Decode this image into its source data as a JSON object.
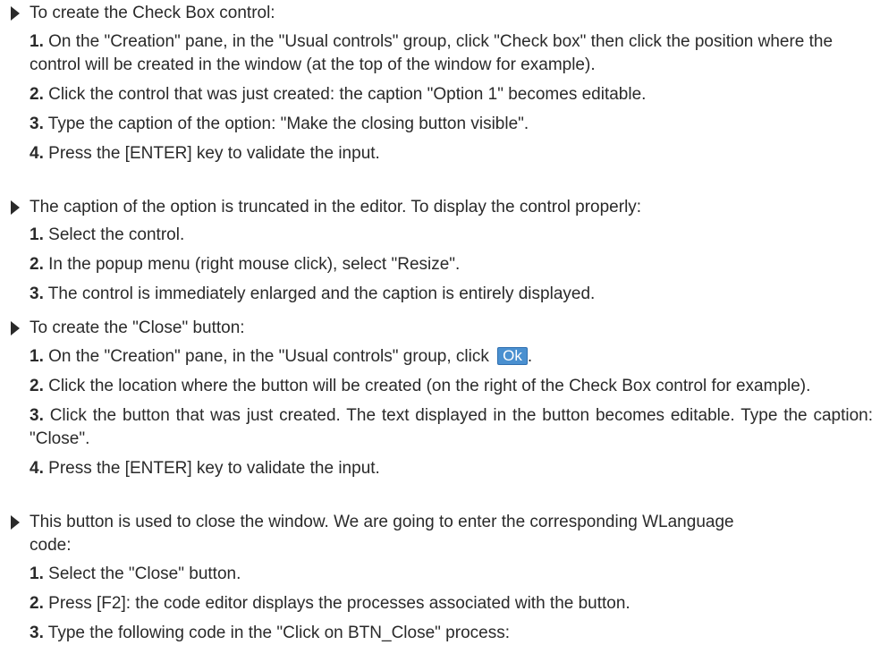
{
  "sections": [
    {
      "lead": "To create the Check Box control:",
      "steps": [
        {
          "num": "1.",
          "text": "On the \"Creation\" pane, in the \"Usual controls\" group, click \"Check box\" then click the position where the control will be created in the window (at the top of the window for example)."
        },
        {
          "num": "2.",
          "text": "Click the control that was just created: the caption \"Option 1\" becomes editable."
        },
        {
          "num": "3.",
          "text": "Type the caption of the option: \"Make the closing button visible\"."
        },
        {
          "num": "4.",
          "text": "Press the [ENTER] key to validate the input."
        }
      ]
    },
    {
      "lead": "The caption of the option is truncated in the editor. To display the control properly:",
      "steps": [
        {
          "num": "1.",
          "text": "Select the control."
        },
        {
          "num": "2.",
          "text": "In the popup menu (right mouse click), select \"Resize\"."
        },
        {
          "num": "3.",
          "text": "The control is immediately enlarged and the caption is entirely displayed."
        }
      ]
    },
    {
      "lead": "To create the \"Close\" button:",
      "steps": [
        {
          "num": "1.",
          "text": "On the \"Creation\" pane, in the \"Usual controls\" group, click",
          "button": "Ok",
          "after": "."
        },
        {
          "num": "2.",
          "text": "Click the location where the button will be created (on the right of the Check Box control for example)."
        },
        {
          "num": "3.",
          "text": "Click the button that was just created. The text displayed in the button becomes editable. Type the caption: \"Close\"."
        },
        {
          "num": "4.",
          "text": "Press the [ENTER] key to validate the input."
        }
      ]
    },
    {
      "lead": "This button is used to close the window. We are going to enter the corresponding WLanguage code:",
      "steps": [
        {
          "num": "1.",
          "text": "Select the \"Close\" button."
        },
        {
          "num": "2.",
          "text": "Press [F2]: the code editor displays the processes associated with the button."
        },
        {
          "num": "3.",
          "text": "Type the following code in the \"Click on BTN_Close\" process:"
        }
      ]
    }
  ]
}
